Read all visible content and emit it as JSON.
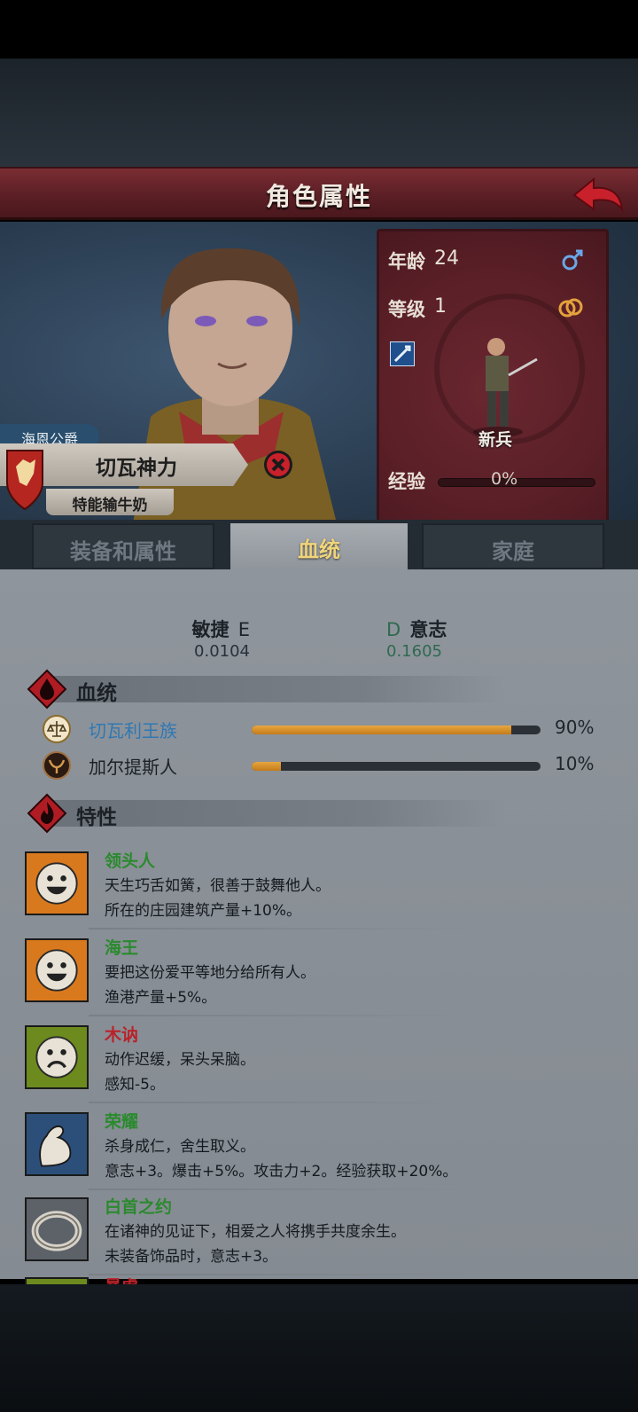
{
  "header": {
    "title": "角色属性"
  },
  "character": {
    "house": "海恩公爵",
    "name": "切瓦神力",
    "nickname": "特能输牛奶"
  },
  "stats": {
    "age_label": "年龄",
    "age_value": "24",
    "level_label": "等级",
    "level_value": "1",
    "unit_name": "新兵",
    "exp_label": "经验",
    "exp_pct": "0%",
    "exp_fraction": 0
  },
  "tabs": [
    {
      "label": "装备和属性",
      "active": false
    },
    {
      "label": "血统",
      "active": true
    },
    {
      "label": "家庭",
      "active": false
    }
  ],
  "attributes": {
    "left": {
      "name": "敏捷",
      "grade": "E",
      "value": "0.0104"
    },
    "right": {
      "name": "意志",
      "grade": "D",
      "value": "0.1605"
    }
  },
  "bloodline": {
    "title": "血统",
    "items": [
      {
        "name": "切瓦利王族",
        "pct": "90%",
        "fraction": 0.9,
        "color": "#2f78b4",
        "icon": "scales-icon"
      },
      {
        "name": "加尔提斯人",
        "pct": "10%",
        "fraction": 0.1,
        "color": "#1b2127",
        "icon": "bull-crest-icon"
      }
    ]
  },
  "traits": {
    "title": "特性",
    "items": [
      {
        "name": "领头人",
        "kind": "good",
        "icon": "happy-face-icon",
        "line1": "天生巧舌如簧，很善于鼓舞他人。",
        "line2": "所在的庄园建筑产量+10%。"
      },
      {
        "name": "海王",
        "kind": "good",
        "icon": "happy-face-icon",
        "line1": "要把这份爱平等地分给所有人。",
        "line2": "渔港产量+5%。"
      },
      {
        "name": "木讷",
        "kind": "bad",
        "icon": "sad-face-icon",
        "line1": "动作迟缓，呆头呆脑。",
        "line2": "感知-5。"
      },
      {
        "name": "荣耀",
        "kind": "good",
        "icon": "flexed-arm-icon",
        "line1": "杀身成仁，舍生取义。",
        "line2": "意志+3。爆击+5%。攻击力+2。经验获取+20%。"
      },
      {
        "name": "白首之约",
        "kind": "good",
        "icon": "ring-icon",
        "line1": "在诸神的见证下，相爱之人将携手共度余生。",
        "line2": "未装备饰品时，意志+3。"
      },
      {
        "name": "暴虐",
        "kind": "bad",
        "icon": "partial-icon",
        "line1": "",
        "line2": ""
      }
    ]
  },
  "colors": {
    "accent_gold": "#f0d47a",
    "good": "#2a8a2e",
    "bad": "#b8232a",
    "header_red": "#5b1f25"
  }
}
